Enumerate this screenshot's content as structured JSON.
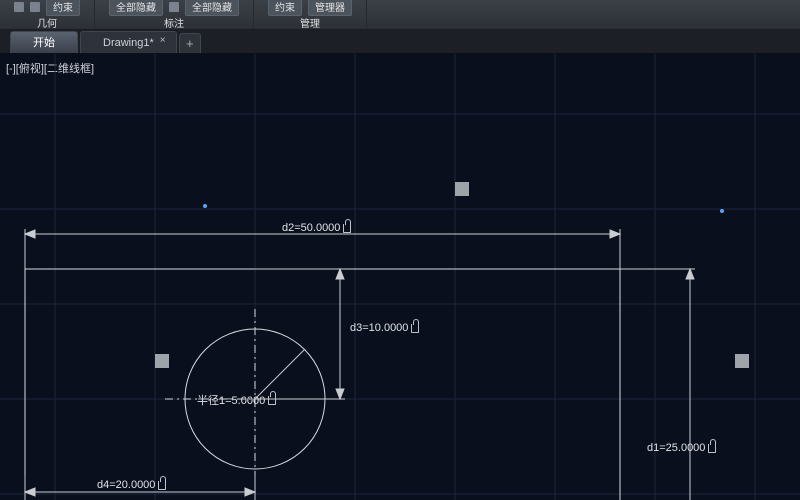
{
  "ribbon": {
    "panels": [
      {
        "label": "几何",
        "btn1": "约束"
      },
      {
        "label": "标注",
        "btn1": "全部隐藏",
        "btn2": "全部隐藏"
      },
      {
        "label": "管理",
        "btn1": "约束",
        "btn2": "管理器"
      }
    ]
  },
  "tabs": {
    "home": "开始",
    "drawing": "Drawing1*"
  },
  "viewport_label": "[-][俯视][二维线框]",
  "dims": {
    "d1": "d1=25.0000",
    "d2": "d2=50.0000",
    "d3": "d3=10.0000",
    "d4": "d4=20.0000",
    "radius": "半径1=5.0000"
  }
}
